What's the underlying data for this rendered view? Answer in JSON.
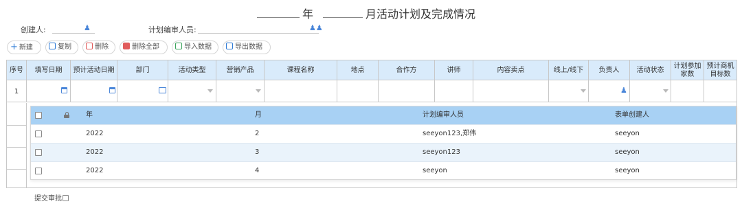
{
  "title": {
    "year_value": "",
    "year_label": "年",
    "month_value": "",
    "month_suffix": "月活动计划及完成情况"
  },
  "meta": {
    "creator_label": "创建人:",
    "creator_value": "",
    "planner_label": "计划编审人员:",
    "planner_value": ""
  },
  "toolbar": [
    {
      "id": "new",
      "label": "新建",
      "icon": "plus-icon",
      "color": "#2f7bd6"
    },
    {
      "id": "copy",
      "label": "复制",
      "icon": "copy-icon",
      "color": "#2f7bd6"
    },
    {
      "id": "delete",
      "label": "删除",
      "icon": "trash-icon",
      "color": "#e05b5b"
    },
    {
      "id": "delete-all",
      "label": "删除全部",
      "icon": "trash-all-icon",
      "color": "#e05b5b"
    },
    {
      "id": "import",
      "label": "导入数据",
      "icon": "import-icon",
      "color": "#3aa35b"
    },
    {
      "id": "export",
      "label": "导出数据",
      "icon": "export-icon",
      "color": "#2f7bd6"
    }
  ],
  "table": {
    "columns": [
      "序号",
      "填写日期",
      "预计活动日期",
      "部门",
      "活动类型",
      "营销产品",
      "课程名称",
      "地点",
      "合作方",
      "讲师",
      "内容卖点",
      "线上/线下",
      "负责人",
      "活动状态",
      "计划参加家数",
      "预计商机目标数"
    ],
    "first_row_seq": "1"
  },
  "popup": {
    "headers": {
      "year": "年",
      "month": "月",
      "planner": "计划编审人员",
      "creator": "表单创建人"
    },
    "rows": [
      {
        "year": "2022",
        "month": "2",
        "planner": "seeyon123,郑伟",
        "creator": "seeyon"
      },
      {
        "year": "2022",
        "month": "3",
        "planner": "seeyon123",
        "creator": "seeyon"
      },
      {
        "year": "2022",
        "month": "4",
        "planner": "seeyon",
        "creator": "seeyon"
      }
    ]
  },
  "submit_label": "提交审批",
  "colors": {
    "header_bg": "#d9ebfb",
    "popup_header_bg": "#a8d1f4",
    "popup_alt_row": "#eaf3fb",
    "icon_blue": "#4a86d9"
  }
}
